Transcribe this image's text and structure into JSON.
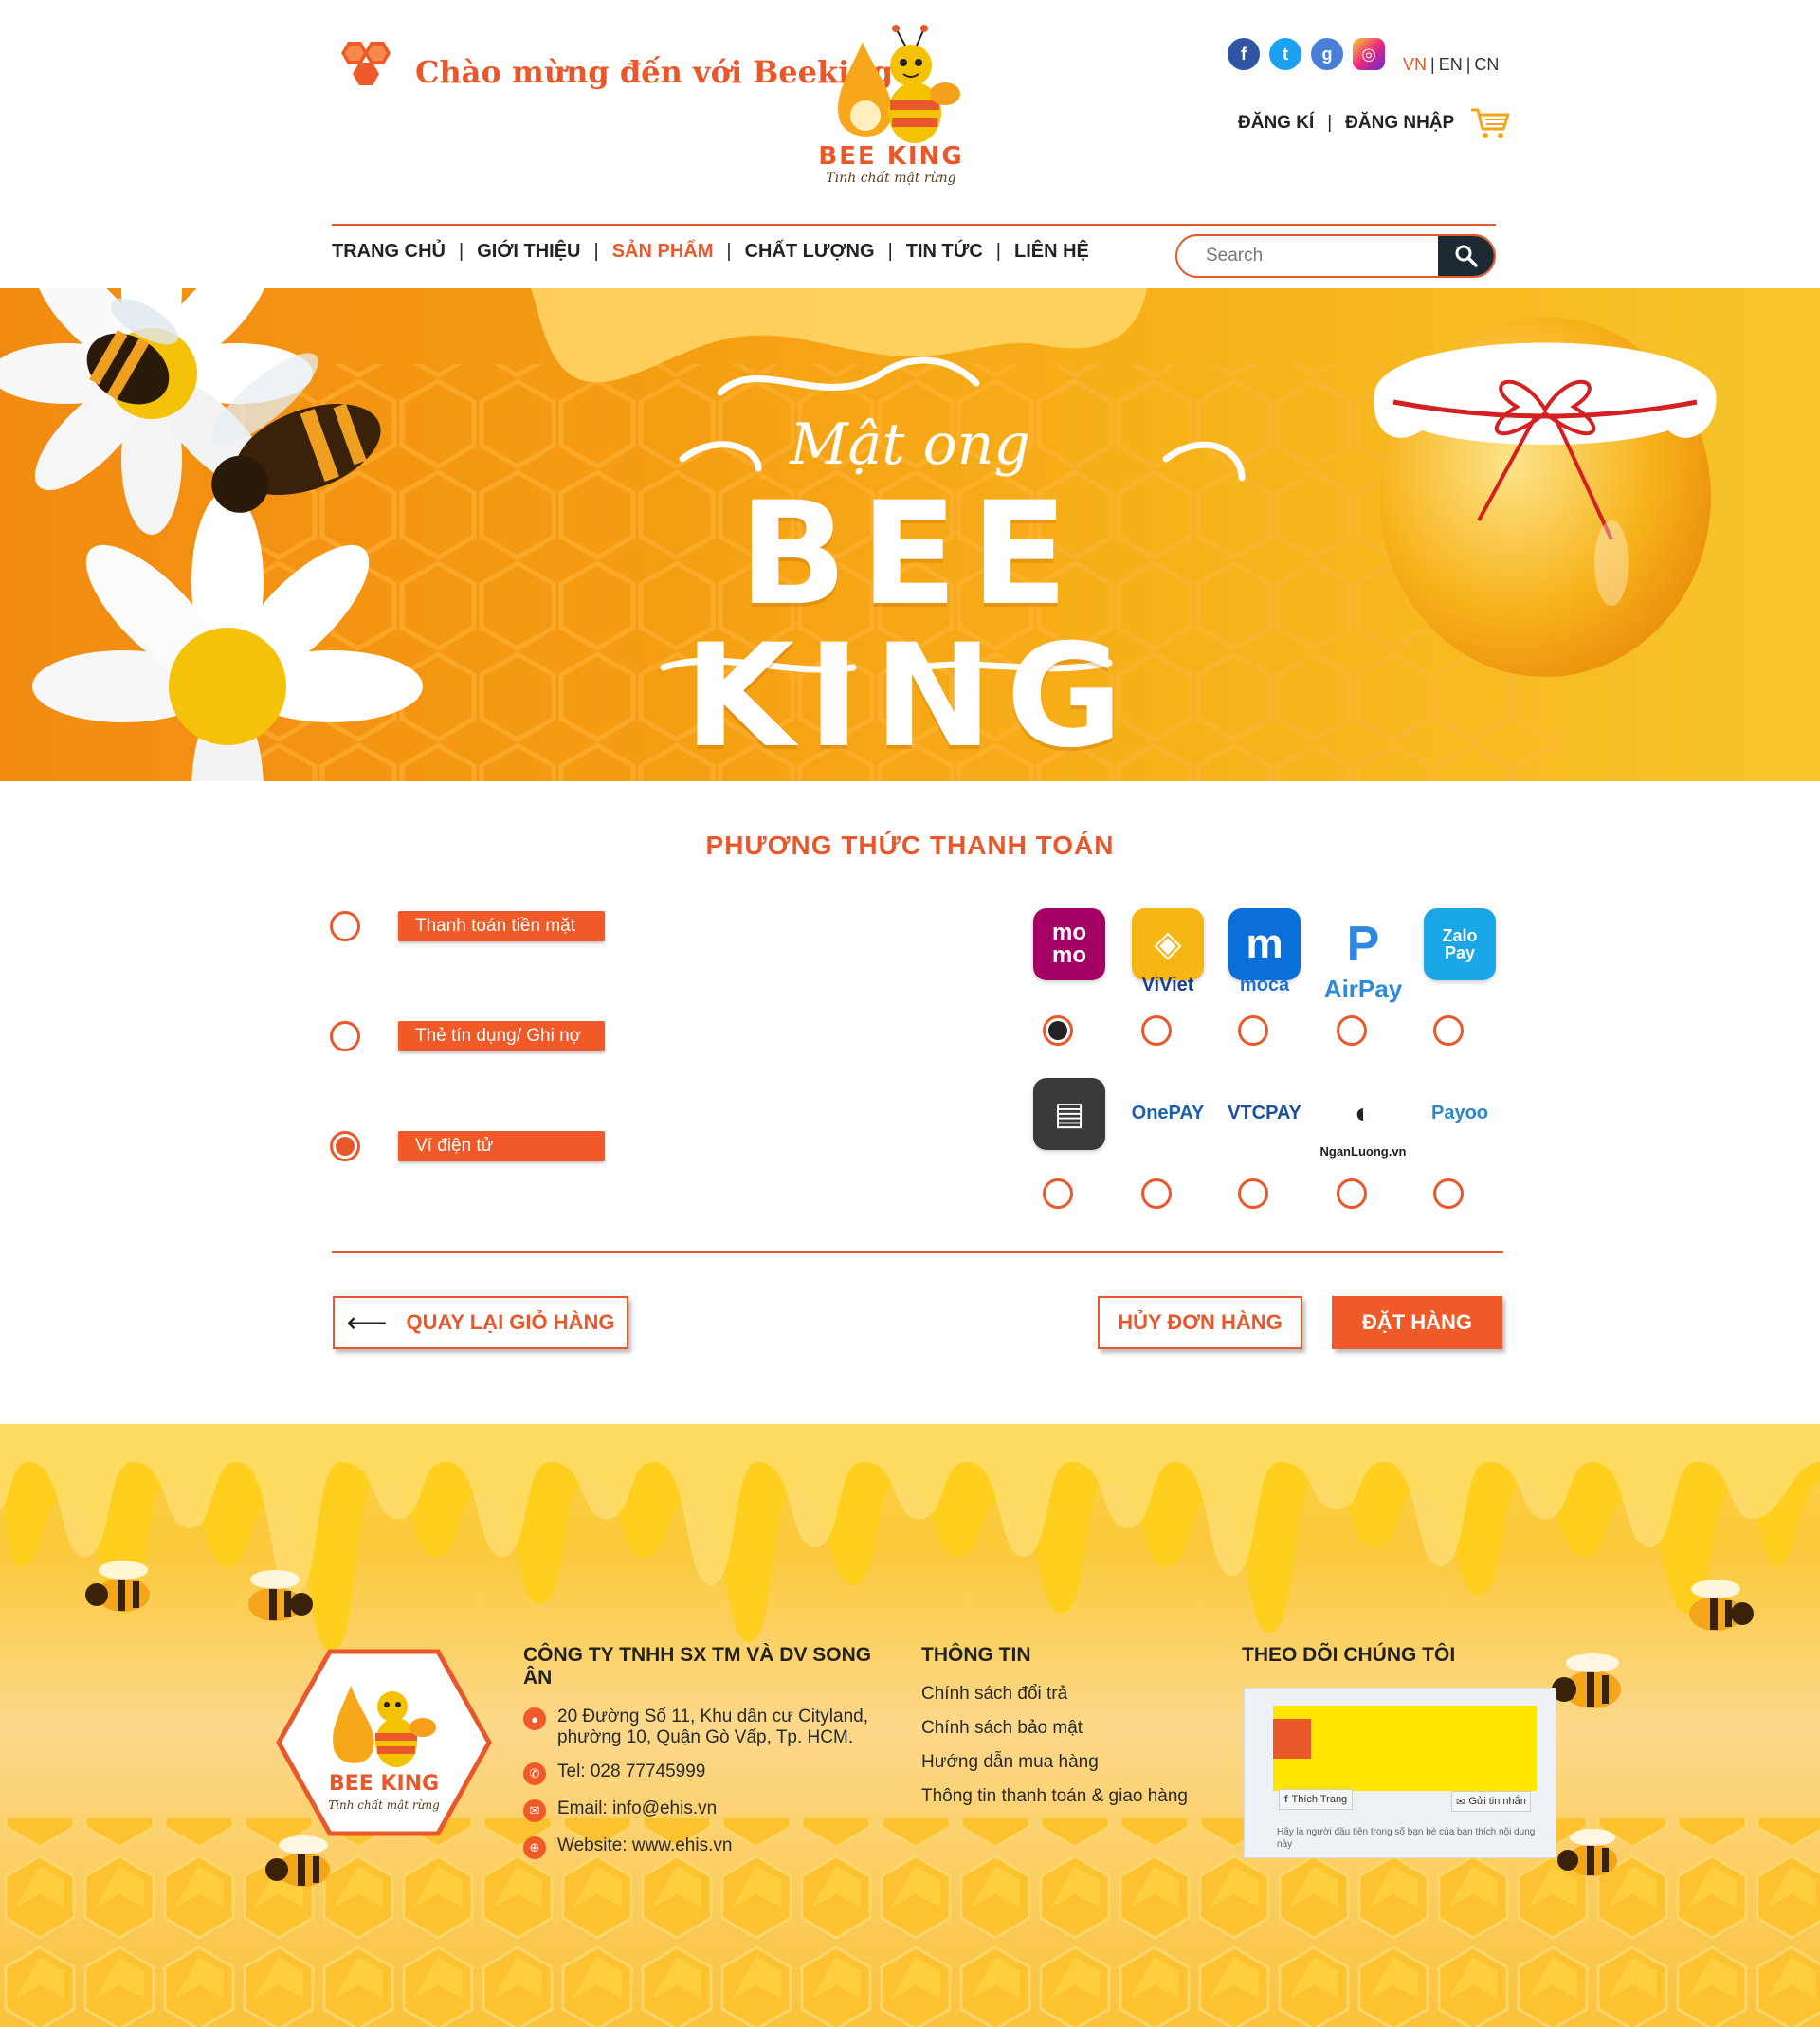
{
  "header": {
    "welcome": "Chào mừng đến với Beeking",
    "brand_name": "BEE KING",
    "brand_slogan": "Tinh chất mật rừng",
    "languages": [
      "VN",
      "EN",
      "CN"
    ],
    "register": "ĐĂNG KÍ",
    "login": "ĐĂNG NHẬP",
    "search_placeholder": "Search"
  },
  "nav": {
    "items": [
      "TRANG CHỦ",
      "GIỚI THIỆU",
      "SẢN PHẨM",
      "CHẤT LƯỢNG",
      "TIN TỨC",
      "LIÊN HỆ"
    ],
    "active_index": 2
  },
  "banner": {
    "subtitle": "Mật ong",
    "title": "BEE KING"
  },
  "payment": {
    "title": "PHƯƠNG THỨC THANH TOÁN",
    "options": [
      {
        "label": "Thanh toán tiền mặt",
        "selected": false
      },
      {
        "label": "Thẻ tín dụng/ Ghi nợ",
        "selected": false
      },
      {
        "label": "Ví điện tử",
        "selected": true
      }
    ],
    "wallets_row1": [
      {
        "name": "momo",
        "caption": "",
        "selected": true
      },
      {
        "name": "ViViet",
        "caption": "ViViet",
        "selected": false
      },
      {
        "name": "moca",
        "caption": "moca",
        "selected": false
      },
      {
        "name": "AirPay",
        "caption": "AirPay",
        "selected": false
      },
      {
        "name": "ZaloPay",
        "caption": "",
        "selected": false
      }
    ],
    "wallets_row2": [
      {
        "name": "wepay",
        "caption": "",
        "selected": false
      },
      {
        "name": "OnePAY",
        "caption": "OnePAY",
        "selected": false
      },
      {
        "name": "VTCPAY",
        "caption": "VTCPAY",
        "selected": false
      },
      {
        "name": "NganLuong",
        "caption": "NganLuong.vn",
        "selected": false
      },
      {
        "name": "Payoo",
        "caption": "Payoo",
        "selected": false
      }
    ],
    "back_button": "QUAY LẠI GIỎ HÀNG",
    "cancel_button": "HỦY ĐƠN HÀNG",
    "order_button": "ĐẶT HÀNG"
  },
  "footer": {
    "company": "CÔNG TY TNHH SX TM VÀ DV SONG ÂN",
    "address_line1": "20 Đường Số 11, Khu dân cư Cityland,",
    "address_line2": "phường 10, Quận Gò Vấp, Tp. HCM.",
    "tel": "Tel: 028 77745999",
    "email": "Email: info@ehis.vn",
    "website": "Website: www.ehis.vn",
    "info_title": "THÔNG TIN",
    "info_links": [
      "Chính sách đổi trả",
      "Chính sách bảo mật",
      "Hướng dẫn mua hàng",
      "Thông tin thanh toán & giao hàng"
    ],
    "follow_title": "THEO DÕI CHÚNG TÔI",
    "fb_like": "Thích Trang",
    "fb_message": "Gửi tin nhắn",
    "fb_note": "Hãy là người đầu tiên trong số bạn bè của bạn thích nội dung này"
  },
  "colors": {
    "accent": "#e8582a",
    "button": "#ef5a28",
    "honey": "#f7b21a",
    "dark": "#1e2a33"
  }
}
